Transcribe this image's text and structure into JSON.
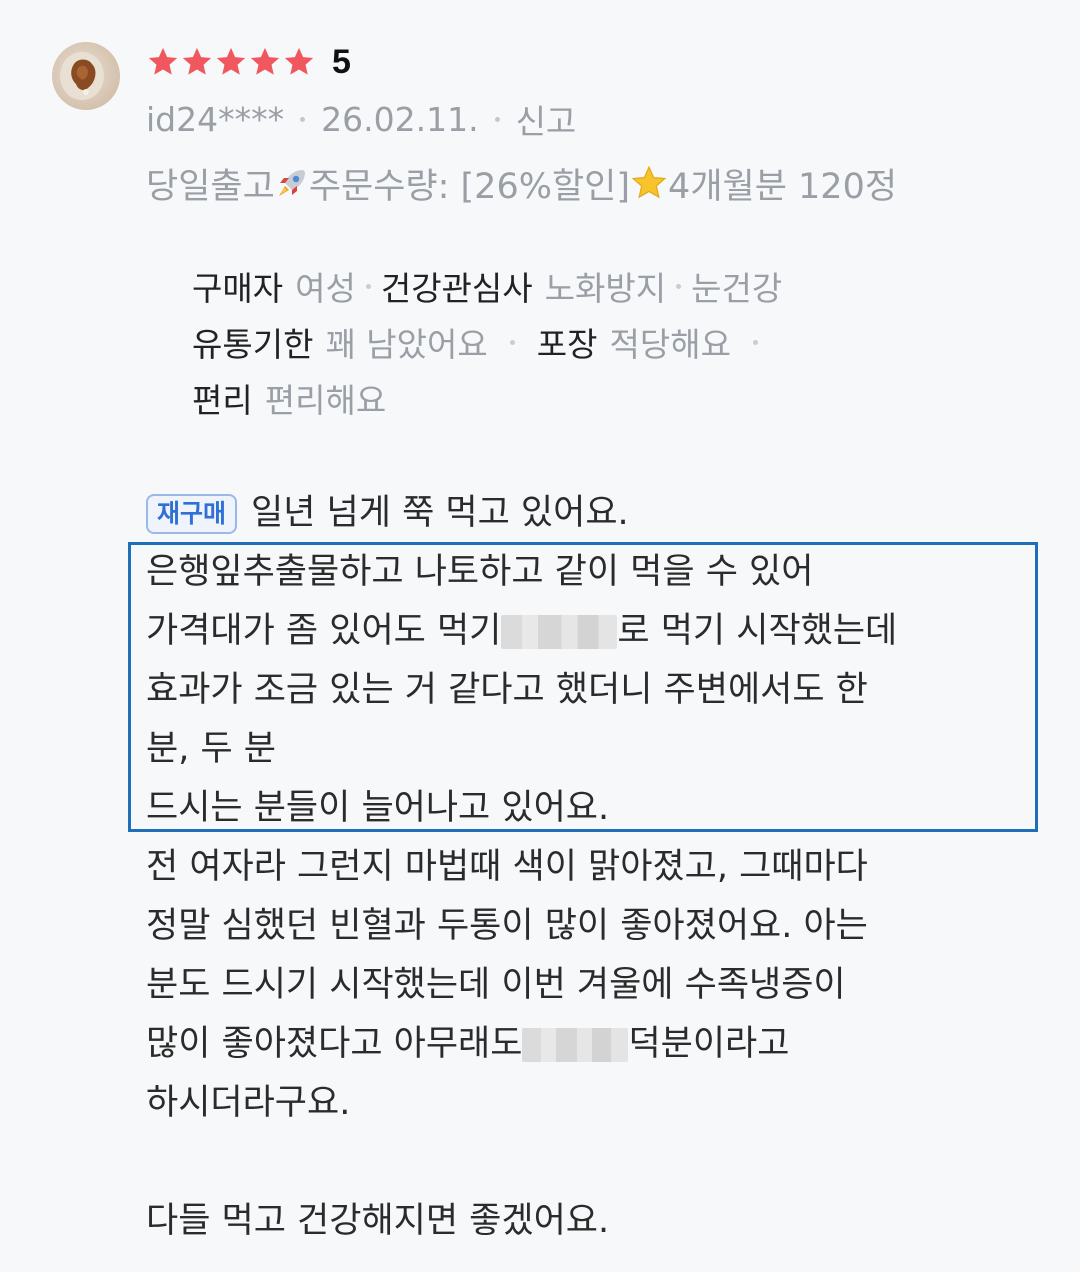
{
  "review": {
    "rating": "5",
    "star_count": 5,
    "star_color": "#f0575e",
    "user": "id24****",
    "date": "26.02.11.",
    "report_label": "신고",
    "option": {
      "prefix": "당일출고",
      "emoji": "rocket-icon",
      "suffix": "주문수량: [26%할인] ",
      "star_emoji": "star-icon",
      "tail": " 4개월분 120정"
    },
    "attributes": {
      "line1": [
        {
          "key": "구매자",
          "value": "여성"
        },
        {
          "key": "건강관심사",
          "value": "노화방지"
        },
        {
          "key": "",
          "value": "눈건강"
        }
      ],
      "line2": [
        {
          "key": "유통기한",
          "value": "꽤 남았어요"
        },
        {
          "key": "포장",
          "value": "적당해요"
        }
      ],
      "line3": [
        {
          "key": "편리",
          "value": "편리해요"
        }
      ]
    },
    "badge": "재구매",
    "body": {
      "l1": "일년 넘게 쭉 먹고 있어요.",
      "l2": "은행잎추출물하고 나토하고 같이 먹을 수 있어",
      "l3a": "가격대가 좀 있어도 먹기 ",
      "l3b": "로 먹기 시작했는데",
      "l4": "효과가 조금 있는 거 같다고 했더니 주변에서도 한",
      "l5": "분, 두 분",
      "l6": "드시는 분들이 늘어나고 있어요.",
      "l7": "전 여자라 그런지 마법때 색이 맑아졌고, 그때마다",
      "l8": "정말 심했던 빈혈과 두통이 많이 좋아졌어요. 아는",
      "l9": "분도 드시기 시작했는데 이번 겨울에 수족냉증이",
      "l10a": "많이 좋아졌다고 아무래도 ",
      "l10b": " 덕분이라고",
      "l11": "하시더라구요.",
      "l12": "다들 먹고 건강해지면 좋겠어요."
    },
    "highlight_color": "#1e6fb8"
  }
}
